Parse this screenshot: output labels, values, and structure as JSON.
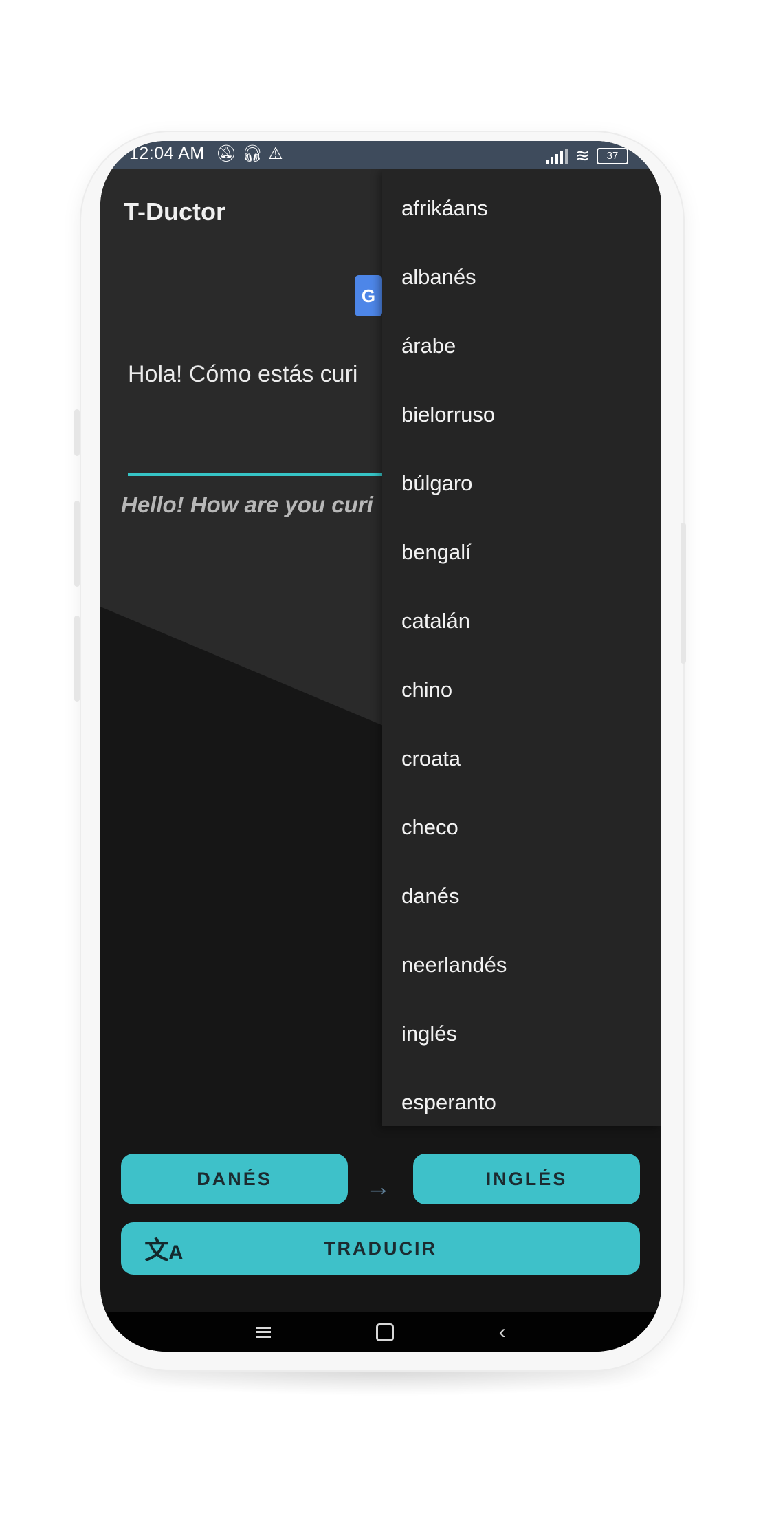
{
  "status_bar": {
    "time": "12:04 AM",
    "icons": [
      "bell-off-icon",
      "headphones-icon",
      "warning-icon"
    ],
    "battery": "37"
  },
  "app": {
    "title": "T-Ductor",
    "google_badge": "G",
    "input_text": "Hola! Cómo estás curi",
    "output_text": "Hello! How are you curi"
  },
  "dropdown": {
    "items": [
      "afrikáans",
      "albanés",
      "árabe",
      "bielorruso",
      "búlgaro",
      "bengalí",
      "catalán",
      "chino",
      "croata",
      "checo",
      "danés",
      "neerlandés",
      "inglés",
      "esperanto"
    ]
  },
  "controls": {
    "source_language": "DANÉS",
    "arrow": "→",
    "target_language": "INGLÉS",
    "translate_button": "TRADUCIR"
  },
  "colors": {
    "accent": "#3ec1c9",
    "background": "#161616",
    "status_bar": "#3e4b5c"
  }
}
